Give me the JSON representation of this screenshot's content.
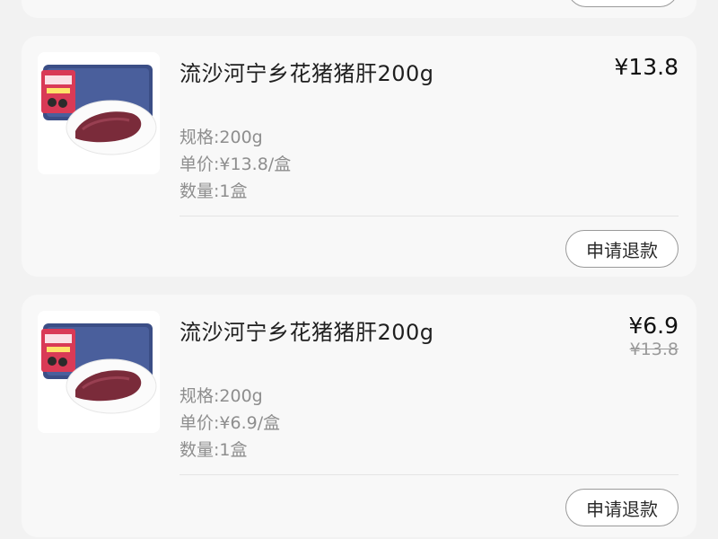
{
  "orders": [
    {
      "name": "流沙河宁乡花猪猪肝200g",
      "price": "¥13.8",
      "original_price": "",
      "spec": "规格:200g",
      "unit_price": "单价:¥13.8/盒",
      "quantity": "数量:1盒",
      "refund_label": "申请退款",
      "image": "pork-liver-product-photo"
    },
    {
      "name": "流沙河宁乡花猪猪肝200g",
      "price": "¥6.9",
      "original_price": "¥13.8",
      "spec": "规格:200g",
      "unit_price": "单价:¥6.9/盒",
      "quantity": "数量:1盒",
      "refund_label": "申请退款",
      "image": "pork-liver-product-photo"
    }
  ],
  "colors": {
    "background": "#f2f2f2",
    "card": "#f8f8f8",
    "text_primary": "#1f1f1f",
    "text_secondary": "#8e8e8e",
    "strike_price": "#9a9a9a",
    "button_border": "#9a9a9a"
  }
}
